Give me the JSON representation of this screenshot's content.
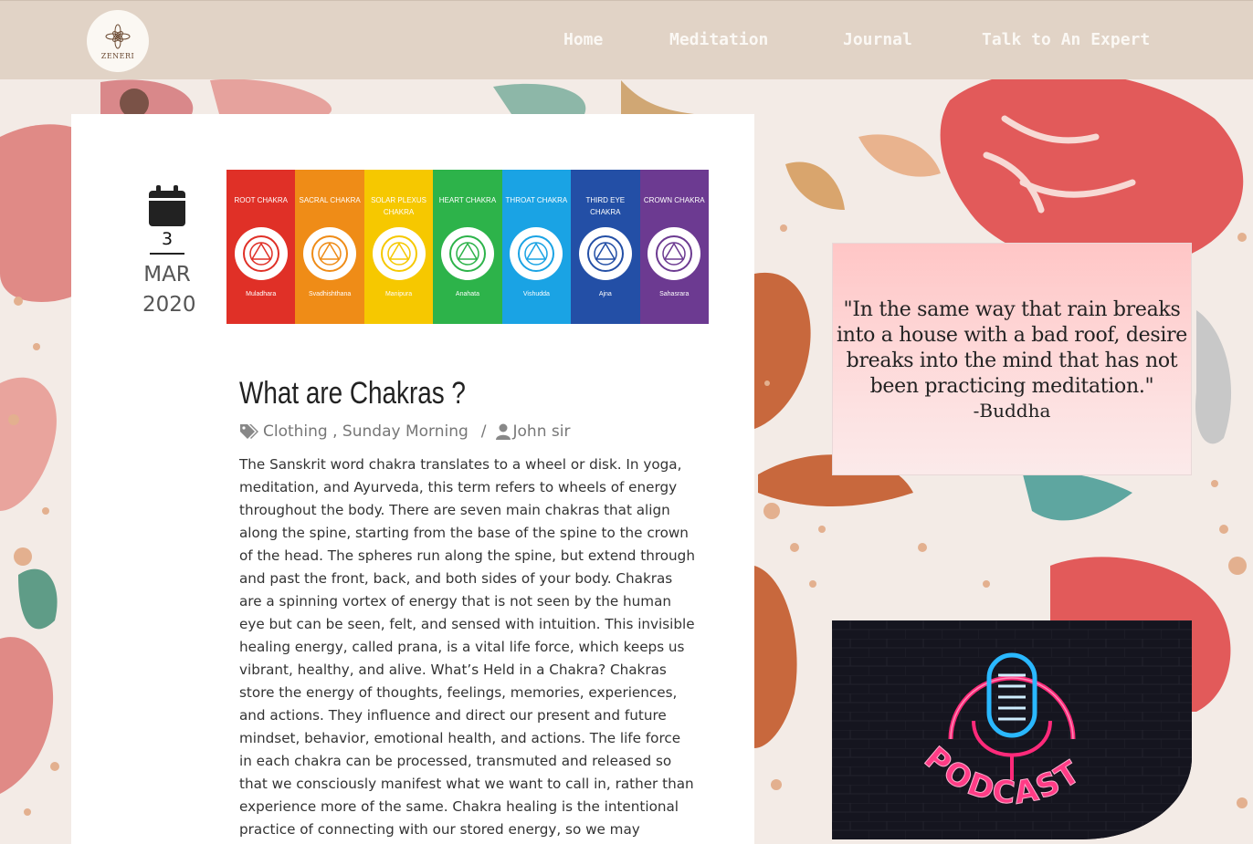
{
  "brand": {
    "logo_text": "ZENERI"
  },
  "nav": {
    "items": [
      {
        "label": "Home"
      },
      {
        "label": "Meditation"
      },
      {
        "label": "Journal"
      },
      {
        "label": "Talk to An Expert"
      }
    ]
  },
  "post": {
    "date": {
      "day": "3",
      "month": "MAR",
      "year": "2020"
    },
    "title": "What are Chakras ?",
    "categories": "Clothing , Sunday Morning",
    "separator": "/",
    "author": "John sir",
    "body": "The Sanskrit word chakra translates to a wheel or disk. In yoga, meditation, and Ayurveda, this term refers to wheels of energy throughout the body. There are seven main chakras that align along the spine, starting from the base of the spine to the crown of the head. The spheres run along the spine, but extend through and past the front, back, and both sides of your body. Chakras are a spinning vortex of energy that is not seen by the human eye but can be seen, felt, and sensed with intuition. This invisible healing energy, called prana, is a vital life force, which keeps us vibrant, healthy, and alive. What’s Held in a Chakra? Chakras store the energy of thoughts, feelings, memories, experiences, and actions. They influence and direct our present and future mindset, behavior, emotional health, and actions. The life force in each chakra can be processed, transmuted and released so that we consciously manifest what we want to call in, rather than experience more of the same. Chakra healing is the intentional practice of connecting with our stored energy, so we may"
  },
  "chakras": [
    {
      "name": "ROOT CHAKRA",
      "sub": "Muladhara",
      "color": "#e03027"
    },
    {
      "name": "SACRAL CHAKRA",
      "sub": "Svadhishthana",
      "color": "#ef8c17"
    },
    {
      "name": "SOLAR PLEXUS CHAKRA",
      "sub": "Manipura",
      "color": "#f6c800"
    },
    {
      "name": "HEART CHAKRA",
      "sub": "Anahata",
      "color": "#2db34a"
    },
    {
      "name": "THROAT CHAKRA",
      "sub": "Vishudda",
      "color": "#1aa3e4"
    },
    {
      "name": "THIRD EYE CHAKRA",
      "sub": "Ajna",
      "color": "#234fa6"
    },
    {
      "name": "CROWN CHAKRA",
      "sub": "Sahasrara",
      "color": "#6c3a91"
    }
  ],
  "quote": {
    "text": "\"In the same way that rain breaks into a house with a bad roof, desire breaks into the mind that has not been practicing meditation.\"",
    "author": "-Buddha"
  },
  "podcast": {
    "label": "PODCAST"
  },
  "colors": {
    "nav_bg": "#e1d3c6",
    "nav_text": "#fbf8f4",
    "card_bg": "#ffffff"
  }
}
